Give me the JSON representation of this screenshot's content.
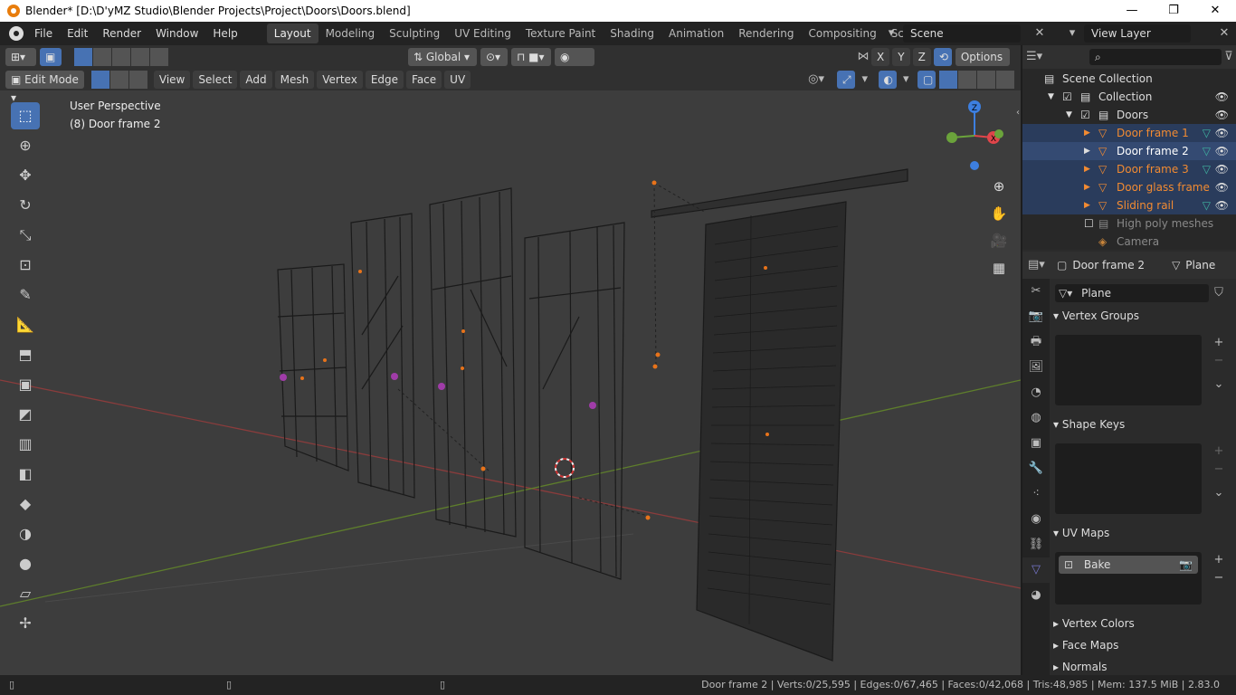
{
  "window": {
    "title": "Blender* [D:\\D'yMZ Studio\\Blender Projects\\Project\\Doors\\Doors.blend]",
    "min": "—",
    "max": "❐",
    "close": "✕"
  },
  "menu": [
    "File",
    "Edit",
    "Render",
    "Window",
    "Help"
  ],
  "workspaces": [
    "Layout",
    "Modeling",
    "Sculpting",
    "UV Editing",
    "Texture Paint",
    "Shading",
    "Animation",
    "Rendering",
    "Compositing",
    "Scripting"
  ],
  "workspace_add": "+",
  "scene": "Scene",
  "view_layer": "View Layer",
  "viewport_header": {
    "orientation": "Global",
    "options": "Options",
    "axes": [
      "X",
      "Y",
      "Z"
    ]
  },
  "mode": "Edit Mode",
  "header_menus": [
    "View",
    "Select",
    "Add",
    "Mesh",
    "Vertex",
    "Edge",
    "Face",
    "UV"
  ],
  "overlay": {
    "perspective": "User Perspective",
    "object": "(8) Door frame 2"
  },
  "gizmo": {
    "z": "Z",
    "x": "X",
    "colors": {
      "x": "#e0454a",
      "y": "#6ba33b",
      "z": "#3d7fe0"
    }
  },
  "tools": [
    "select-box",
    "cursor",
    "move",
    "rotate",
    "scale",
    "transform",
    "annotate",
    "measure",
    "extrude",
    "inset",
    "bevel",
    "loop-cut",
    "knife",
    "poly-build",
    "spin",
    "smooth",
    "shrink-fatten",
    "shear"
  ],
  "outliner": {
    "scene_collection": "Scene Collection",
    "collection": "Collection",
    "doors": "Doors",
    "items": [
      "Door frame 1",
      "Door frame 2",
      "Door frame 3",
      "Door glass frame",
      "Sliding rail"
    ],
    "high_poly": "High poly meshes",
    "camera": "Camera"
  },
  "properties": {
    "object": "Door frame 2",
    "data_type": "Plane",
    "mesh_name": "Plane",
    "sections": [
      "Vertex Groups",
      "Shape Keys",
      "UV Maps",
      "Vertex Colors",
      "Face Maps",
      "Normals"
    ],
    "uv_map": "Bake"
  },
  "status": "Door frame 2 | Verts:0/25,595 | Edges:0/67,465 | Faces:0/42,068 | Tris:48,985 | Mem: 137.5 MiB | 2.83.0",
  "colors": {
    "accent": "#4772b3",
    "selected_object": "#f28b32"
  }
}
